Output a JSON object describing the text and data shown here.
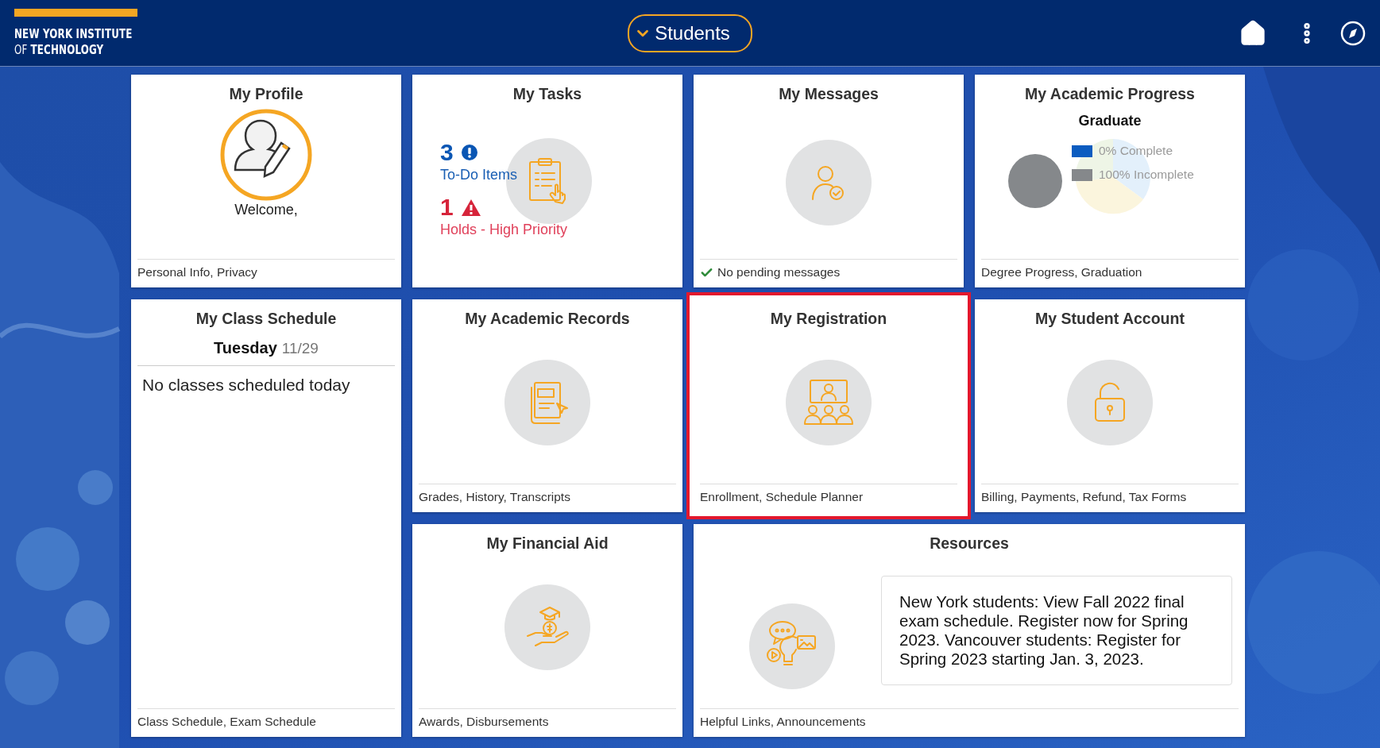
{
  "header": {
    "logo_lines": [
      "NEW YORK INSTITUTE",
      "OF **TECHNOLOGY**"
    ],
    "title": "Students"
  },
  "tiles": [
    {
      "kind": "profile",
      "title": "My Profile",
      "welcome": "Welcome,",
      "footer": "Personal Info, Privacy",
      "highlighted": false
    },
    {
      "kind": "tasks",
      "title": "My Tasks",
      "todo_count": "3",
      "todo_label": "To-Do Items",
      "holds_count": "1",
      "holds_label": "Holds - High Priority",
      "highlighted": false
    },
    {
      "kind": "messages",
      "title": "My Messages",
      "footer": "No pending messages",
      "highlighted": false
    },
    {
      "kind": "progress",
      "title": "My Academic Progress",
      "chart_data": {
        "type": "pie",
        "title": "Graduate",
        "categories": [
          "0% Complete",
          "100% Incomplete"
        ],
        "values": [
          0,
          100
        ]
      },
      "slices": [
        {
          "color": "#0b5cc0"
        },
        {
          "color": "#85888b"
        }
      ],
      "footer": "Degree Progress, Graduation",
      "highlighted": false
    },
    {
      "kind": "schedule",
      "title": "My Class Schedule",
      "day": "Tuesday",
      "date": "11/29",
      "message": "No classes scheduled today",
      "footer": "Class Schedule, Exam Schedule",
      "highlighted": false
    },
    {
      "kind": "records",
      "title": "My Academic Records",
      "footer": "Grades, History, Transcripts",
      "highlighted": false
    },
    {
      "kind": "registration",
      "title": "My Registration",
      "footer": "Enrollment, Schedule Planner",
      "highlighted": true
    },
    {
      "kind": "account",
      "title": "My Student Account",
      "footer": "Billing, Payments, Refund, Tax Forms",
      "highlighted": false
    },
    {
      "kind": "aid",
      "title": "My Financial Aid",
      "footer": "Awards, Disbursements",
      "highlighted": false
    },
    {
      "kind": "resources",
      "title": "Resources",
      "announcement": "New York students: View Fall 2022 final exam schedule. Register now for Spring 2023. Vancouver students: Register for Spring 2023 starting Jan. 3, 2023.",
      "footer": "Helpful Links, Announcements",
      "highlighted": false
    }
  ]
}
